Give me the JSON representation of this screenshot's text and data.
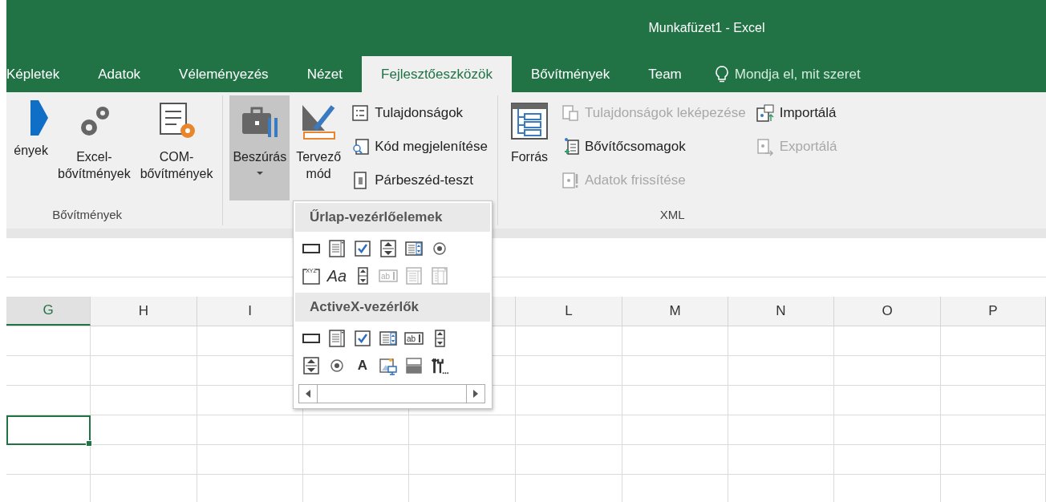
{
  "window": {
    "title": "Munkafüzet1 - Excel"
  },
  "tabs": [
    {
      "label": "Képletek",
      "selected": false
    },
    {
      "label": "Adatok",
      "selected": false
    },
    {
      "label": "Véleményezés",
      "selected": false
    },
    {
      "label": "Nézet",
      "selected": false
    },
    {
      "label": "Fejlesztőeszközök",
      "selected": true
    },
    {
      "label": "Bővítmények",
      "selected": false
    },
    {
      "label": "Team",
      "selected": false
    }
  ],
  "tell_me": {
    "placeholder": "Mondja el, mit szeret"
  },
  "ribbon": {
    "groups": [
      {
        "label": "Bővítmények",
        "items": [
          {
            "kind": "large",
            "label": "ények",
            "pressed": false
          },
          {
            "kind": "large",
            "label": "Excel-bővítmények",
            "pressed": false
          },
          {
            "kind": "large",
            "label": "COM-bővítmények",
            "pressed": false
          }
        ]
      },
      {
        "items": [
          {
            "kind": "large",
            "label": "Beszúrás",
            "pressed": true,
            "dropdown": true
          },
          {
            "kind": "large",
            "label": "Tervező mód",
            "pressed": false
          },
          {
            "kind": "small",
            "label": "Tulajdonságok",
            "disabled": false
          },
          {
            "kind": "small",
            "label": "Kód megjelenítése",
            "disabled": false
          },
          {
            "kind": "small",
            "label": "Párbeszéd-teszt",
            "disabled": false
          }
        ]
      },
      {
        "label": "XML",
        "items": [
          {
            "kind": "large",
            "label": "Forrás",
            "pressed": false
          },
          {
            "kind": "small",
            "label": "Tulajdonságok leképezése",
            "disabled": true
          },
          {
            "kind": "small",
            "label": "Bővítőcsomagok",
            "disabled": false
          },
          {
            "kind": "small",
            "label": "Adatok frissítése",
            "disabled": true
          },
          {
            "kind": "small",
            "label": "Importálá",
            "disabled": false
          },
          {
            "kind": "small",
            "label": "Exportálá",
            "disabled": true
          }
        ]
      }
    ]
  },
  "insert_menu": {
    "sections": [
      {
        "title": "Űrlap-vezérlőelemek",
        "controls": [
          {
            "kind": "button",
            "disabled": false
          },
          {
            "kind": "combo",
            "disabled": false
          },
          {
            "kind": "checkbox",
            "disabled": false
          },
          {
            "kind": "spin",
            "disabled": false
          },
          {
            "kind": "list",
            "disabled": false
          },
          {
            "kind": "radio",
            "disabled": false
          },
          {
            "kind": "group",
            "text": "XYZ",
            "disabled": false
          },
          {
            "kind": "label",
            "text": "Aa",
            "disabled": false
          },
          {
            "kind": "scroll",
            "disabled": false
          },
          {
            "kind": "textbox",
            "text": "ab",
            "disabled": true
          },
          {
            "kind": "combolist",
            "disabled": true
          },
          {
            "kind": "combodrop",
            "disabled": true
          }
        ]
      },
      {
        "title": "ActiveX-vezérlők",
        "controls": [
          {
            "kind": "button",
            "disabled": false
          },
          {
            "kind": "combo",
            "disabled": false
          },
          {
            "kind": "checkbox",
            "disabled": false
          },
          {
            "kind": "list",
            "disabled": false
          },
          {
            "kind": "textbox",
            "text": "ab",
            "disabled": false
          },
          {
            "kind": "scroll",
            "disabled": false
          },
          {
            "kind": "spin",
            "disabled": false
          },
          {
            "kind": "radio",
            "disabled": false
          },
          {
            "kind": "plainlabel",
            "text": "A",
            "disabled": false
          },
          {
            "kind": "image",
            "disabled": false
          },
          {
            "kind": "toggle",
            "disabled": false
          },
          {
            "kind": "tools",
            "disabled": false
          }
        ]
      }
    ]
  },
  "sheet": {
    "columns": [
      {
        "label": "G",
        "selected": true
      },
      {
        "label": "H",
        "selected": false
      },
      {
        "label": "I",
        "selected": false
      },
      {
        "label": "L",
        "selected": false
      },
      {
        "label": "M",
        "selected": false
      },
      {
        "label": "N",
        "selected": false
      },
      {
        "label": "O",
        "selected": false
      },
      {
        "label": "P",
        "selected": false
      }
    ],
    "rows": [
      {
        "selected": false
      },
      {
        "selected": false
      },
      {
        "selected": false
      },
      {
        "selected": true
      },
      {
        "selected": false
      },
      {
        "selected": false
      }
    ]
  }
}
